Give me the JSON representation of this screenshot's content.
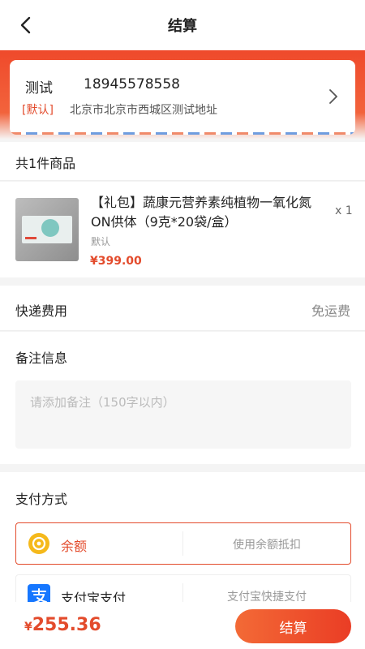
{
  "nav": {
    "title": "结算"
  },
  "address": {
    "name": "测试",
    "phone": "18945578558",
    "tag": "[默认]",
    "detail": "北京市北京市西城区测试地址"
  },
  "goods": {
    "header": "共1件商品",
    "items": [
      {
        "name": "【礼包】蔬康元营养素纯植物一氧化氮ON供体（9克*20袋/盒）",
        "spec": "默认",
        "price": "¥399.00",
        "qty": "x 1"
      }
    ]
  },
  "shipping": {
    "label": "快递费用",
    "value": "免运费"
  },
  "remark": {
    "label": "备注信息",
    "placeholder": "请添加备注（150字以内）"
  },
  "payment": {
    "label": "支付方式",
    "options": [
      {
        "name": "余额",
        "desc": "使用余额抵扣",
        "selected": true,
        "icon": "coin-icon"
      },
      {
        "name": "支付宝支付",
        "desc": "支付宝快捷支付",
        "selected": false,
        "icon": "alipay-icon"
      }
    ]
  },
  "footer": {
    "currency": "¥",
    "total": "255.36",
    "button": "结算"
  },
  "colors": {
    "accent": "#e34b2c",
    "alipay": "#1677ff",
    "coin": "#f5b91b"
  }
}
